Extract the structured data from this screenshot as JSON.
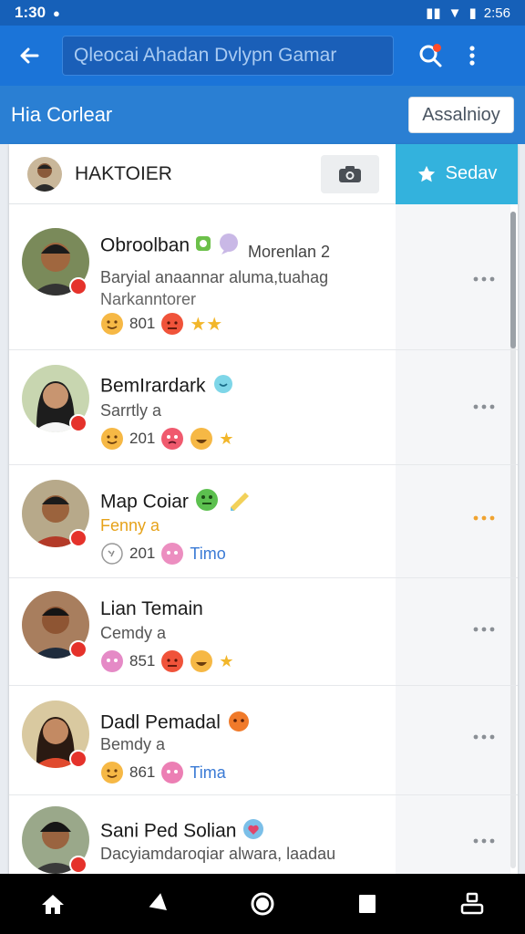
{
  "status_bar": {
    "time": "1:30",
    "battery": "2:56"
  },
  "app_bar": {
    "search_text": "Qleocai Ahadan Dvlypn Gamar"
  },
  "subheader": {
    "title": "Hia Corlear",
    "action_label": "Assalnioy"
  },
  "card": {
    "title": "HAKTOIER",
    "follow_label": "Sedav"
  },
  "colors": {
    "primary": "#1b74d8",
    "accent": "#33b2dd",
    "badge": "#e5322b"
  },
  "contacts": [
    {
      "name": "Obroolban",
      "time_note": "Morenlan 2",
      "message": "Baryial anaannar aluma,tuahag",
      "message2": "Narkanntorer",
      "count": "801",
      "tag": ""
    },
    {
      "name": "BemIrardark",
      "time_note": "",
      "message": "Sarrtly a",
      "message2": "",
      "count": "201",
      "tag": ""
    },
    {
      "name": "Map Coiar",
      "time_note": "",
      "message": "Fenny a",
      "message2": "",
      "count": "201",
      "tag": "Timo"
    },
    {
      "name": "Lian Temain",
      "time_note": "",
      "message": "Cemdy a",
      "message2": "",
      "count": "851",
      "tag": ""
    },
    {
      "name": "Dadl Pemadal",
      "time_note": "",
      "message": "Bemdy a",
      "message2": "",
      "count": "861",
      "tag": "Tima"
    },
    {
      "name": "Sani Ped Solian",
      "time_note": "",
      "message": "Dacyiamdaroqiar alwara, laadau",
      "message2": "",
      "count": "",
      "tag": ""
    }
  ]
}
